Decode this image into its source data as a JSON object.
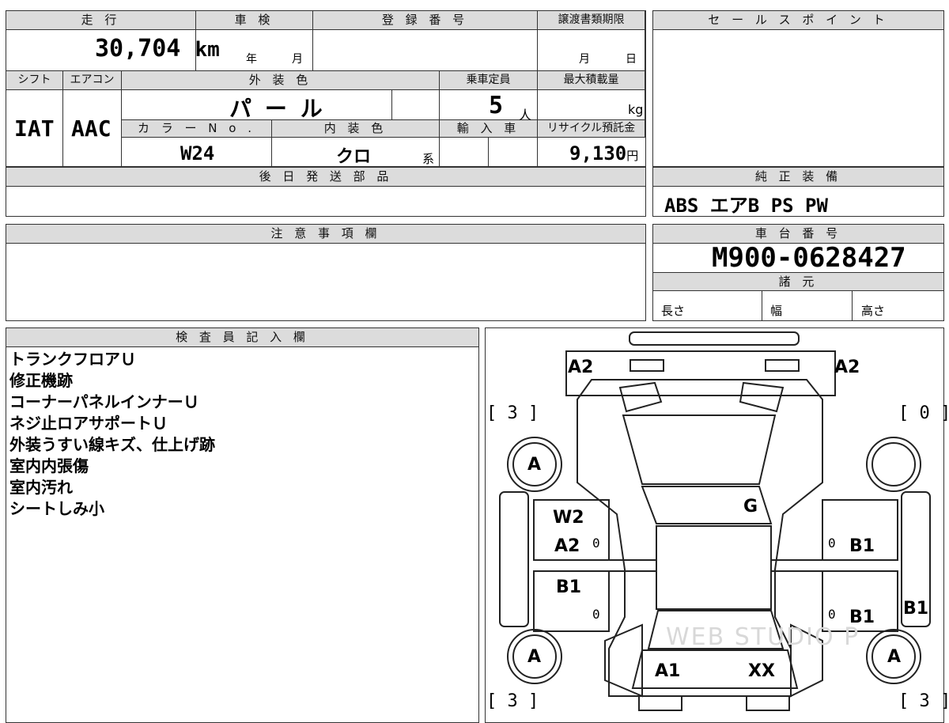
{
  "top": {
    "mileage_label": "走 行",
    "mileage_value": "30,704",
    "mileage_unit": "km",
    "inspection_label": "車 検",
    "inspection_year": "年",
    "inspection_month": "月",
    "reg_label": "登 録 番 号",
    "transfer_label": "譲渡書類期限",
    "transfer_month": "月",
    "transfer_day": "日",
    "sales_label": "セ ー ル ス ポ イ ン ト"
  },
  "specs": {
    "shift_label": "シフト",
    "aircon_label": "エアコン",
    "exterior_label": "外 装 色",
    "capacity_label": "乗車定員",
    "maxload_label": "最大積載量",
    "shift_value": "IAT",
    "aircon_value": "AAC",
    "exterior_value": "パ ー ル",
    "capacity_value": "5",
    "capacity_unit": "人",
    "maxload_unit": "kg",
    "colorno_label": "カ ラ ー N o .",
    "interior_label": "内 装 色",
    "import_label": "輸 入 車",
    "recycle_label": "リサイクル預託金",
    "colorno_value": "W24",
    "interior_value": "クロ",
    "interior_suffix": "系",
    "recycle_value": "9,130",
    "recycle_unit": "円"
  },
  "later_parts": {
    "label": "後 日 発 送 部 品",
    "value": ""
  },
  "equipment": {
    "label": "純 正 装 備",
    "value": "ABS エアB PS PW"
  },
  "notes": {
    "label": "注 意 事 項 欄"
  },
  "chassis": {
    "label": "車 台 番 号",
    "value": "M900-0628427",
    "spec_label": "諸 元",
    "length": "長さ",
    "width": "幅",
    "height": "高さ"
  },
  "inspector": {
    "label": "検 査 員 記 入 欄",
    "lines": [
      "トランクフロアＵ",
      "修正機跡",
      "コーナーパネルインナーＵ",
      "ネジ止ロアサポートＵ",
      "外装うすい線キズ、仕上げ跡",
      "室内内張傷",
      "室内汚れ",
      "シートしみ小"
    ]
  },
  "car_map": {
    "rear_left": "A2",
    "rear_right": "A2",
    "bracket_tl": "[ 3 ]",
    "bracket_tr": "[ 0 ]",
    "bracket_bl": "[ 3 ]",
    "bracket_br": "[ 3 ]",
    "tire_rl": "A",
    "tire_fl": "A",
    "tire_fr": "A",
    "roof": "G",
    "left_rear_door_1": "W2",
    "left_rear_door_2": "A2",
    "left_front_door": "B1",
    "right_rear_door": "B1",
    "right_front_door": "B1",
    "right_fender": "B1",
    "zero_1": "0",
    "zero_2": "0",
    "zero_3": "0",
    "zero_4": "0",
    "front_left": "A1",
    "front_right": "XX",
    "watermark": "WEB STUDIO P"
  }
}
